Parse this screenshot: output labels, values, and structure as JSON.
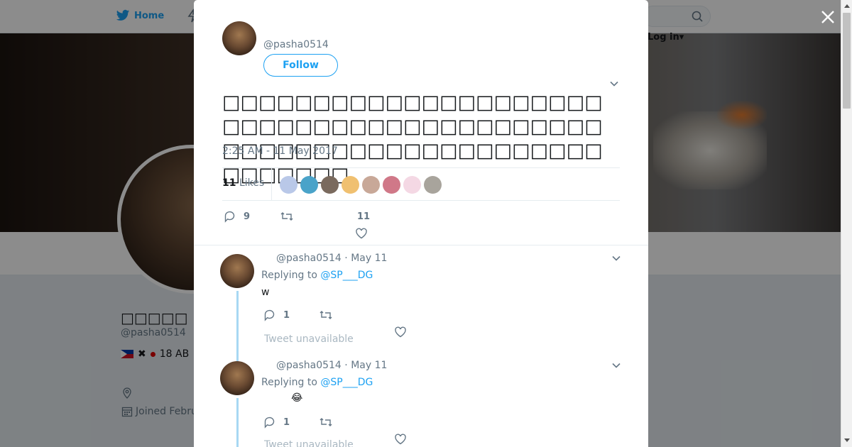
{
  "nav": {
    "home_label": "Home",
    "login_label": "Log in",
    "login_caret": "▾"
  },
  "profile": {
    "name": "□□□□□",
    "handle": "@pasha0514",
    "bio_tail": "18 AB",
    "bio_x": "✖",
    "joined": "Joined Febru"
  },
  "tweet": {
    "handle": "@pasha0514",
    "follow_label": "Follow",
    "text": "□□□□□□□□□□□□□□□□□□□□□□□□□□□□□□□□□□□□□□□□□□□□□□□□□□□□□□□□□□□□□□□□□□□□□□",
    "timestamp": "2:25 AM - 11 May 2017",
    "likes_count": "11",
    "likes_label": "Likes",
    "reply_count": "9",
    "like_count": "11"
  },
  "likers": [
    {
      "color": "#b9c8e8"
    },
    {
      "color": "#4aa3c9"
    },
    {
      "color": "#7a6a5e"
    },
    {
      "color": "#f0c070"
    },
    {
      "color": "#c8a898"
    },
    {
      "color": "#d07888"
    },
    {
      "color": "#f4d8e4"
    },
    {
      "color": "#a8a49c"
    }
  ],
  "replies": [
    {
      "handle_date": "@pasha0514 · May 11",
      "replying_prefix": "Replying to",
      "replying_to": "@SP___DG",
      "body": "w",
      "reply_count": "1",
      "unavailable": "Tweet unavailable"
    },
    {
      "handle_date": "@pasha0514 · May 11",
      "replying_prefix": "Replying to",
      "replying_to": "@SP___DG",
      "body": "😂",
      "reply_count": "1",
      "unavailable": "Tweet unavailable"
    }
  ],
  "colors": {
    "accent": "#1da1f2",
    "muted": "#657786",
    "thread": "#a8d8f3"
  }
}
